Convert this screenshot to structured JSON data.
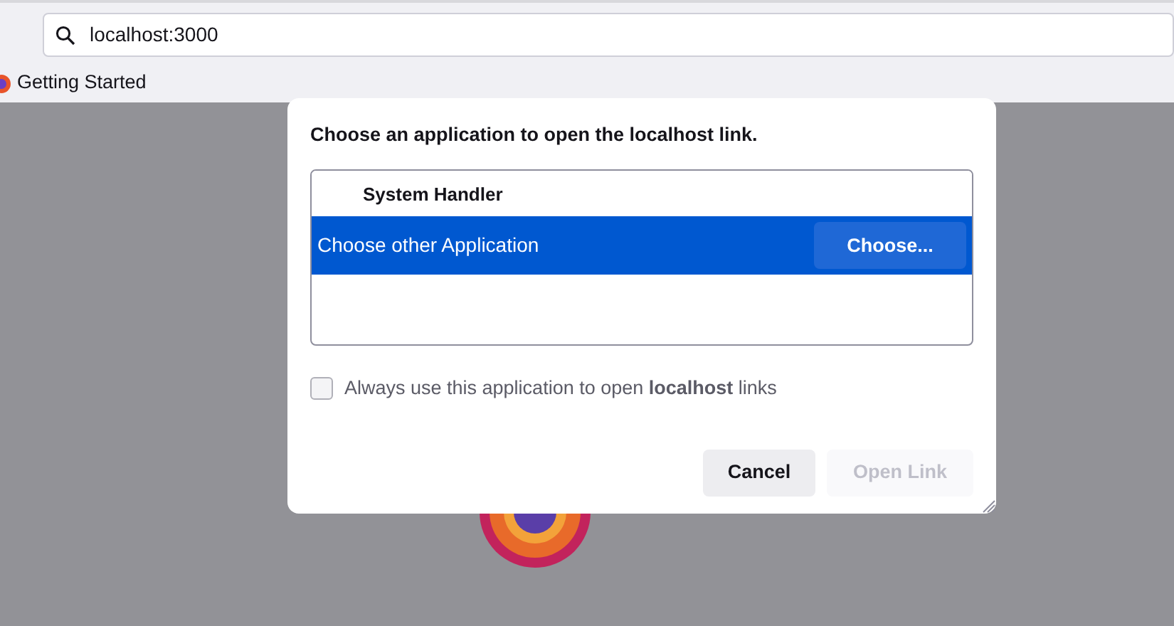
{
  "address_bar": {
    "value": "localhost:3000"
  },
  "bookmarks": [
    {
      "label": "Getting Started"
    }
  ],
  "dialog": {
    "title": "Choose an application to open the localhost link.",
    "handlers": [
      {
        "kind": "header",
        "label": "System Handler",
        "selected": false
      },
      {
        "kind": "choice",
        "label": "Choose other Application",
        "selected": true,
        "button": "Choose..."
      }
    ],
    "always_use": {
      "label": "Always use this application to open **localhost** links",
      "checked": false
    },
    "buttons": [
      {
        "label": "Cancel",
        "disabled": false
      },
      {
        "label": "Open Link",
        "disabled": true
      }
    ]
  }
}
